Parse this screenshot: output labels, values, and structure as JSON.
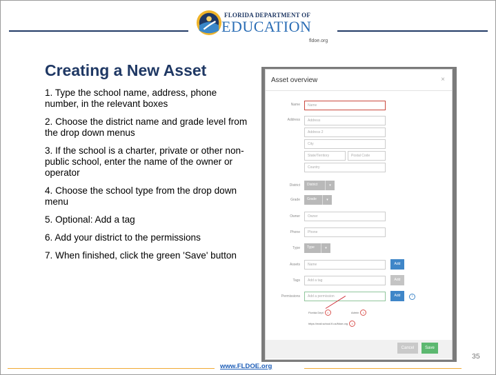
{
  "header": {
    "logo_top": "Florida Department of",
    "logo_main": "EDUCATION",
    "logo_sub": "fldoe.org"
  },
  "title": "Creating a New Asset",
  "steps": [
    "1. Type the school name, address, phone number, in the relevant boxes",
    "2. Choose the district name and grade level from the drop down menus",
    "3. If the school is a charter, private or other non-public school, enter the name of the owner or operator",
    "4. Choose the school type from the drop down menu",
    "5. Optional: Add a tag",
    "6. Add your district to the permissions",
    "7. When finished, click the green 'Save' button"
  ],
  "dialog": {
    "title": "Asset overview",
    "close": "×",
    "labels": {
      "name": "Name",
      "address": "Address",
      "district": "District",
      "grade": "Grade",
      "owner": "Owner",
      "phone": "Phone",
      "type": "Type",
      "assets": "Assets",
      "tags": "Tags",
      "permissions": "Permissions"
    },
    "placeholders": {
      "name": "Name",
      "address": "Address",
      "address2": "Address 2",
      "city": "City",
      "state": "State/Territory",
      "postal": "Postal Code",
      "country": "Country",
      "owner": "Owner",
      "phone": "Phone",
      "assets": "Name",
      "tags": "Add a tag",
      "permissions": "Add a permission"
    },
    "district_value": "District",
    "grade_value": "Grade",
    "type_value": "Type",
    "add_label": "Add",
    "info_glyph": "i",
    "remove_glyph": "x",
    "permission_entries": [
      "Florida Dept",
      "Admin",
      "https://mail.school.fl.us/fldoe.org"
    ],
    "cancel_label": "Cancel",
    "save_label": "Save"
  },
  "footer": {
    "url": "www.FLDOE.org",
    "page": "35"
  },
  "colors": {
    "title": "#1f3864",
    "save": "#5cb870",
    "add": "#3f86c8",
    "footer_line": "#f0a830"
  }
}
